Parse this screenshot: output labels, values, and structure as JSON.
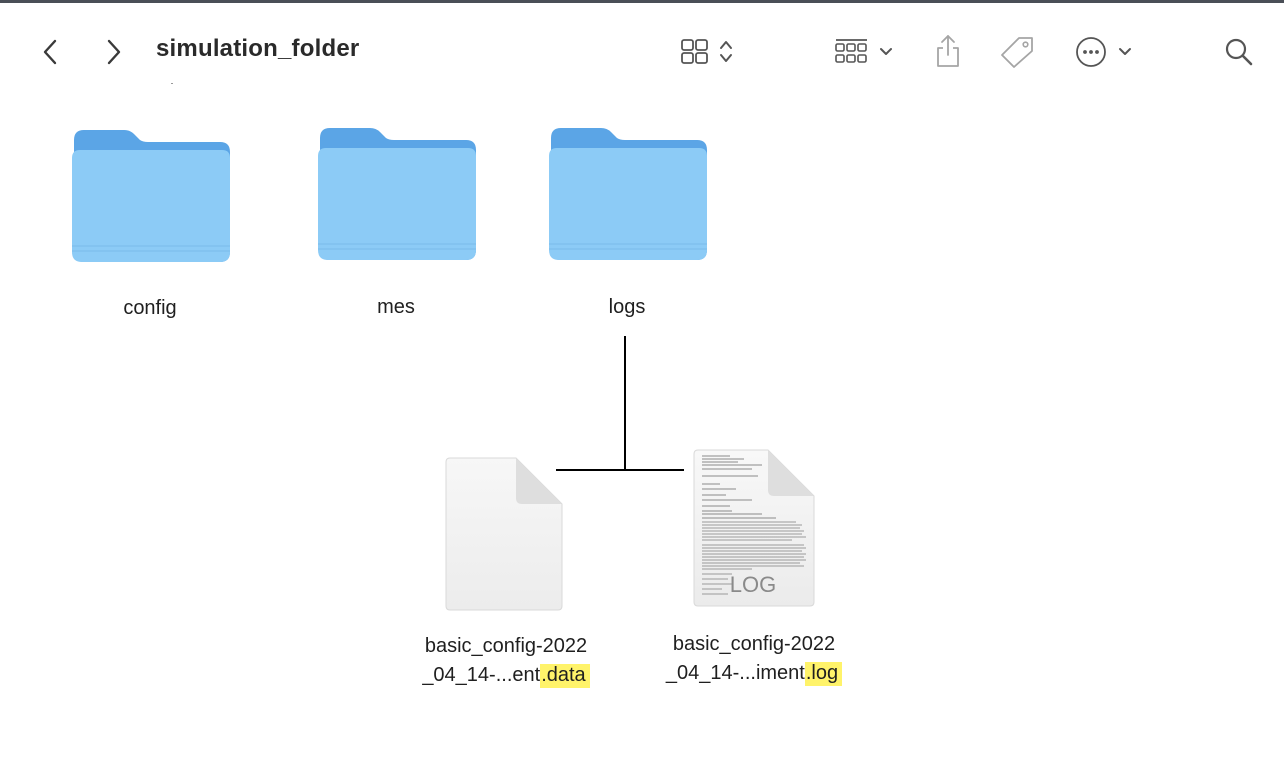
{
  "window": {
    "title": "simulation_folder"
  },
  "toolbar": {
    "back_icon": "chevron-left-icon",
    "forward_icon": "chevron-right-icon",
    "view_icon": "grid-view-icon",
    "group_icon": "group-by-icon",
    "share_icon": "share-icon",
    "tag_icon": "tag-icon",
    "more_icon": "ellipsis-circle-icon",
    "search_icon": "search-icon"
  },
  "folders": [
    {
      "name": "config"
    },
    {
      "name": "mes"
    },
    {
      "name": "logs"
    }
  ],
  "files": [
    {
      "name_line1": "basic_config-2022",
      "name_line2_prefix": "_04_14-...ent",
      "extension": ".data",
      "icon": "blank-document-icon"
    },
    {
      "name_line1": "basic_config-2022",
      "name_line2_prefix": "_04_14-...iment",
      "extension": ".log",
      "icon": "log-document-icon",
      "badge": "LOG"
    }
  ],
  "colors": {
    "folder_back": "#5ba5e6",
    "folder_front": "#8ccbf6",
    "highlight": "#fff36a"
  }
}
